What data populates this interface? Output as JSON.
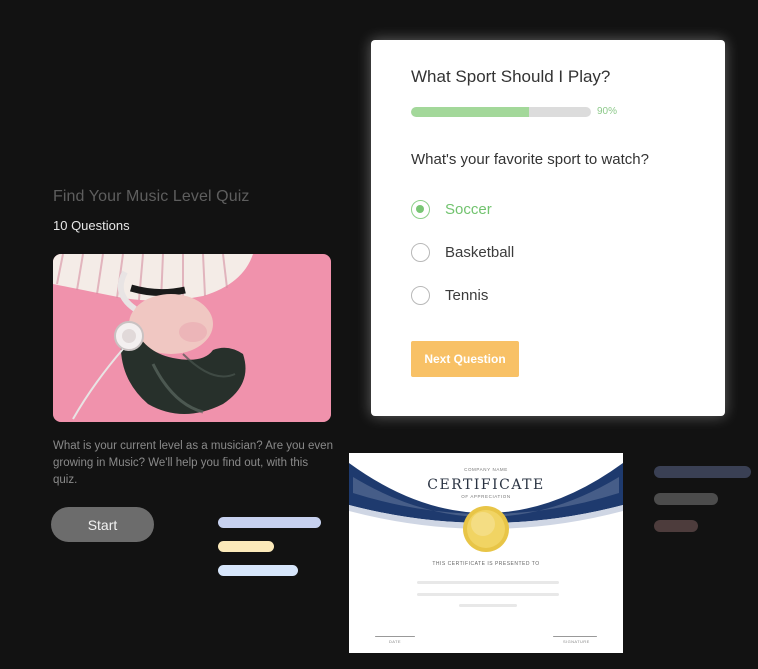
{
  "intro": {
    "title": "Find Your Music Level Quiz",
    "question_count": "10 Questions",
    "description": "What is your current level as a musician? Are you even growing in Music? We'll help you find out, with this quiz.",
    "start_label": "Start"
  },
  "quiz": {
    "title": "What Sport Should I Play?",
    "progress": {
      "value": 0.9,
      "label": "90%"
    },
    "question": "What's your favorite sport to watch?",
    "options": [
      {
        "label": "Soccer",
        "selected": true
      },
      {
        "label": "Basketball",
        "selected": false
      },
      {
        "label": "Tennis",
        "selected": false
      }
    ],
    "next_label": "Next Question"
  },
  "certificate": {
    "company": "COMPANY NAME",
    "title": "CERTIFICATE",
    "subtitle": "OF APPRECIATION",
    "presented": "THIS CERTIFICATE IS PRESENTED TO",
    "date_label": "DATE",
    "signature_label": "SIGNATURE"
  },
  "colors": {
    "background": "#121212",
    "accent_green": "#72c36f",
    "progress_fill": "#a3d89a",
    "button_orange": "#f8c166",
    "start_button": "#6c6c6c",
    "cert_navy": "#1e3a6e",
    "cert_gold": "#e8c547"
  },
  "icons": {
    "selected_radio": "radio-checked-icon",
    "unselected_radio": "radio-unchecked-icon",
    "medal": "gold-medal-icon"
  }
}
